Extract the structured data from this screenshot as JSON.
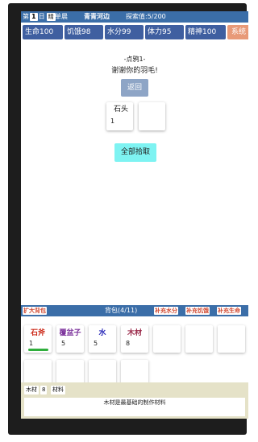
{
  "topbar": {
    "day_prefix": "第",
    "day_number": "1",
    "day_suffix": "日",
    "time": "晴",
    "weather": "单晨",
    "location": "青青河边",
    "explore": "探索值:5/200"
  },
  "stats": {
    "life": "生命100",
    "hunger": "饥饿98",
    "water": "水分99",
    "stamina": "体力95",
    "spirit": "精神100",
    "system": "系统"
  },
  "event": {
    "title": "-点鸦1-",
    "text": "谢谢你的羽毛!",
    "back": "返回",
    "loot": [
      {
        "name": "石头",
        "qty": "1"
      },
      {
        "name": "",
        "qty": ""
      }
    ],
    "collect_all": "全部拾取"
  },
  "backpack": {
    "expand": "扩大背包",
    "title": "背包(4/11)",
    "add_water": "补充水分",
    "add_hunger": "补充饥饿",
    "add_life": "补充生命",
    "items": [
      {
        "name": "石斧",
        "qty": "1",
        "color": "#cc2a1a",
        "durability": 1.0
      },
      {
        "name": "覆盆子",
        "qty": "5",
        "color": "#7a2f9a"
      },
      {
        "name": "水",
        "qty": "5",
        "color": "#2a2ab8"
      },
      {
        "name": "木材",
        "qty": "8",
        "color": "#9a2a4a"
      },
      {
        "name": "",
        "qty": ""
      },
      {
        "name": "",
        "qty": ""
      },
      {
        "name": "",
        "qty": ""
      },
      {
        "name": "",
        "qty": ""
      },
      {
        "name": "",
        "qty": ""
      },
      {
        "name": "",
        "qty": ""
      },
      {
        "name": "",
        "qty": ""
      }
    ]
  },
  "detail": {
    "item_name": "木材",
    "item_qty": "8",
    "item_type": "材料",
    "description": "木材是最基础的制作材料"
  },
  "colors": {
    "bar_blue": "#3b6ea8",
    "stat_blue": "#3f5fa0",
    "system_orange": "#e89a78",
    "collect_cyan": "#7ef3f2",
    "detail_bg": "#e5e2c8"
  }
}
